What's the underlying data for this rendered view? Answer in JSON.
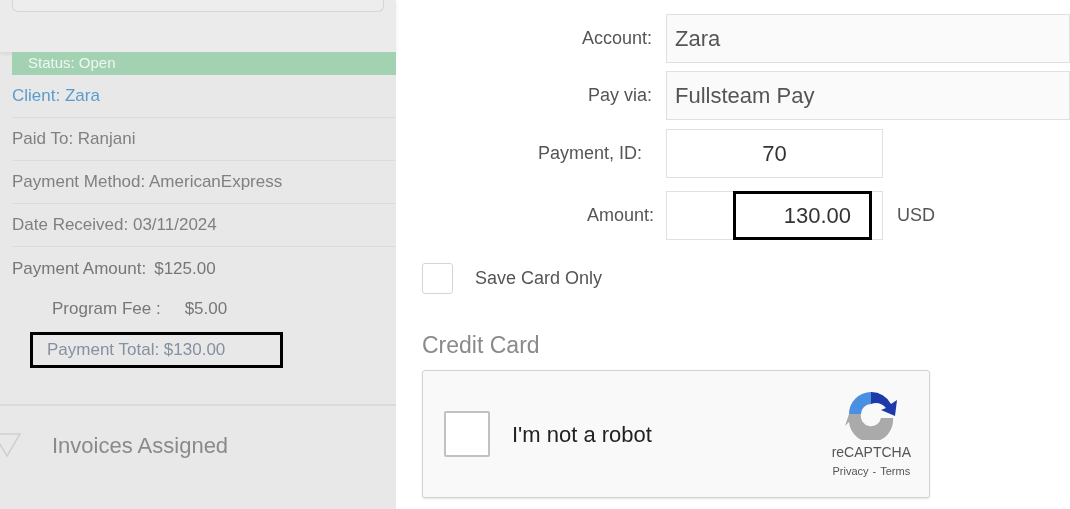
{
  "summary": {
    "status": "Status: Open",
    "client": "Client: Zara",
    "details": [
      "Paid To: Ranjani",
      "Payment Method: AmericanExpress",
      "Date Received: 03/11/2024"
    ],
    "payment_amount": {
      "label": "Payment Amount:",
      "value": "$125.00"
    },
    "program_fee": {
      "label": "Program Fee :",
      "value": "$5.00"
    },
    "payment_total": {
      "text": "Payment Total: $130.00",
      "highlighted": true
    },
    "invoices_section": {
      "label": "Invoices Assigned",
      "expanded": false
    }
  },
  "form": {
    "account": {
      "label": "Account:",
      "value": "Zara"
    },
    "pay_via": {
      "label": "Pay via:",
      "value": "Fullsteam Pay"
    },
    "payment_id": {
      "label": "Payment, ID:",
      "value": "70"
    },
    "amount": {
      "label": "Amount:",
      "value": "130.00",
      "currency": "USD",
      "highlighted": true
    },
    "save_card": {
      "label": "Save Card Only",
      "checked": false
    },
    "credit_card_heading": "Credit Card",
    "captcha": {
      "label": "I'm not a robot",
      "checked": false,
      "brand": "reCAPTCHA",
      "privacy": "Privacy",
      "separator": "-",
      "terms": "Terms"
    }
  }
}
